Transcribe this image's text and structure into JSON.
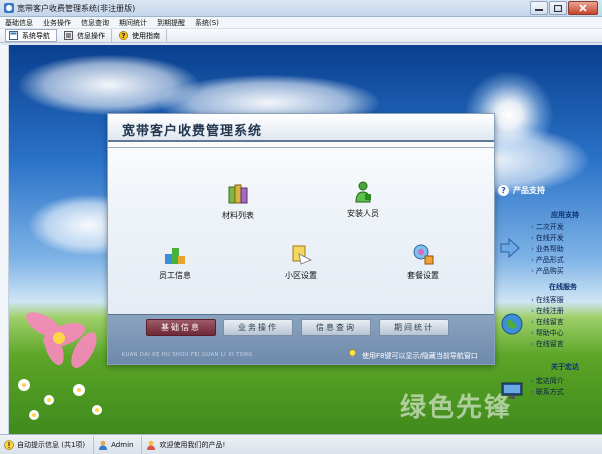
{
  "window": {
    "title": "宽带客户收费管理系统(非注册版)"
  },
  "menu": [
    "基础信息",
    "业务操作",
    "信息查询",
    "期间统计",
    "到期提醒",
    "系统(S)"
  ],
  "toolbar": [
    {
      "label": "系统导航",
      "icon": "navigation-icon",
      "active": true
    },
    {
      "label": "信息操作",
      "icon": "info-operation-icon",
      "active": false
    },
    {
      "label": "使用指南",
      "icon": "help-guide-icon",
      "active": false
    }
  ],
  "dialog": {
    "title": "宽带客户收费管理系统",
    "features": [
      {
        "label": "材料列表",
        "icon": "books-icon"
      },
      {
        "label": "安装人员",
        "icon": "installer-person-icon"
      },
      {
        "label": "员工信息",
        "icon": "employee-icon"
      },
      {
        "label": "小区设置",
        "icon": "community-settings-icon"
      },
      {
        "label": "套餐设置",
        "icon": "package-settings-icon"
      }
    ],
    "tabs": [
      "基础信息",
      "业务操作",
      "信息查询",
      "期间统计"
    ],
    "active_tab": "基础信息",
    "pinyin": "KUAN DAI KE HU SHOU FEI GUAN LI XI TONG",
    "hint": "使用F8键可以显示/隐藏当前导航窗口"
  },
  "side_panel": {
    "header": "产品支持",
    "sections": [
      {
        "title": "应用支持",
        "links": [
          "二次开发",
          "在线开发",
          "业务帮助",
          "产品形式",
          "产品购买"
        ]
      },
      {
        "title": "在线服务",
        "links": [
          "在线客服",
          "在线注册",
          "在线留言",
          "帮助中心",
          "在线留言"
        ]
      },
      {
        "title": "关于宏达",
        "links": [
          "宏达简介",
          "联系方式"
        ]
      }
    ]
  },
  "watermark": "绿色先锋",
  "statusbar": [
    {
      "text": "自动提示信息 (共1项)",
      "icon": "alert-icon"
    },
    {
      "text": "Admin",
      "icon": "user-icon"
    },
    {
      "text": "欢迎使用我们的产品!",
      "icon": "welcome-icon"
    }
  ],
  "colors": {
    "active_tab": "#6e2837",
    "panel_header": "#ffffff",
    "dialog_title": "#23374f"
  }
}
